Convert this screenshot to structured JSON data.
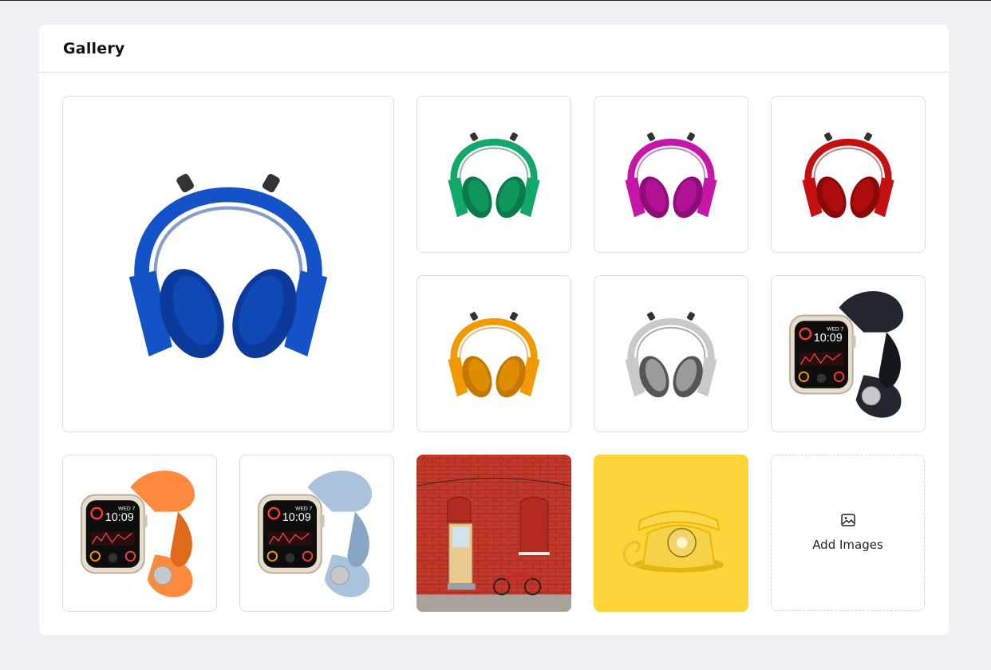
{
  "gallery": {
    "title": "Gallery",
    "add_images_label": "Add Images",
    "add_icon": "image-icon",
    "watch_time": "10:09",
    "watch_date": "WED 7",
    "items": [
      {
        "name": "gallery-item-headphones-blue",
        "kind": "headphones",
        "color": "#1452c8",
        "dark": "#0b3a9a"
      },
      {
        "name": "gallery-item-headphones-green",
        "kind": "headphones",
        "color": "#13a86a",
        "dark": "#0a7a4a"
      },
      {
        "name": "gallery-item-headphones-magenta",
        "kind": "headphones",
        "color": "#c516a8",
        "dark": "#8e0d79"
      },
      {
        "name": "gallery-item-headphones-red",
        "kind": "headphones",
        "color": "#c41010",
        "dark": "#8c0909"
      },
      {
        "name": "gallery-item-headphones-orange",
        "kind": "headphones",
        "color": "#f09a00",
        "dark": "#c47800"
      },
      {
        "name": "gallery-item-headphones-silver",
        "kind": "headphones",
        "color": "#c9c9c9",
        "dark": "#555555"
      },
      {
        "name": "gallery-item-watch-black",
        "kind": "watch",
        "color": "#22262e",
        "dark": "#14171c"
      },
      {
        "name": "gallery-item-watch-orange",
        "kind": "watch",
        "color": "#ff8a3d",
        "dark": "#e06a1c"
      },
      {
        "name": "gallery-item-watch-light-blue",
        "kind": "watch",
        "color": "#a9c3dc",
        "dark": "#86a6c4"
      },
      {
        "name": "gallery-item-red-brick-wall",
        "kind": "wall",
        "color": "#c2392b",
        "dark": "#8f2417"
      },
      {
        "name": "gallery-item-yellow-telephone",
        "kind": "phone",
        "color": "#ffd43b",
        "dark": "#e8b800"
      }
    ]
  }
}
